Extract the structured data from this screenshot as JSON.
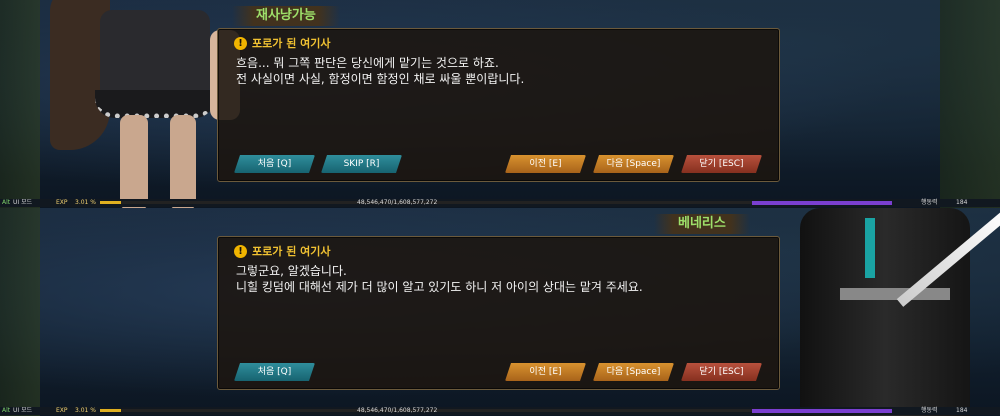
{
  "panels": [
    {
      "speaker": "재사냥가능",
      "header": "포로가 된 여기사",
      "lines": [
        "흐음... 뭐 그쪽 판단은 당신에게 맡기는 것으로 하죠.",
        "전 사실이면 사실, 함정이면 함정인 채로 싸울 뿐이랍니다."
      ],
      "buttons": {
        "first": "처음 [Q]",
        "skip": "SKIP [R]",
        "prev": "이전 [E]",
        "next": "다음 [Space]",
        "close": "닫기 [ESC]"
      }
    },
    {
      "speaker": "베네리스",
      "header": "포로가 된 여기사",
      "lines": [
        "그렇군요, 알겠습니다.",
        "니힐 킹덤에 대해선 제가 더 많이 알고 있기도 하니 저 아이의 상대는 맡겨 주세요."
      ],
      "buttons": {
        "first": "처음 [Q]",
        "prev": "이전 [E]",
        "next": "다음 [Space]",
        "close": "닫기 [ESC]"
      }
    }
  ],
  "status": {
    "alt_key": "Alt",
    "ui_mode": "UI 모드",
    "exp_label": "EXP",
    "exp_percent": "3.01 %",
    "exp_fraction": 0.0301,
    "exp_values": "48,546,470/1,608,577,272",
    "stamina_label": "행동력",
    "stamina_value": "184"
  },
  "colors": {
    "speaker_name": "#9ee06a",
    "header_title": "#f1c232",
    "teal_button": "#2f8e9c",
    "orange_button": "#d8922f",
    "red_button": "#b8513d"
  }
}
